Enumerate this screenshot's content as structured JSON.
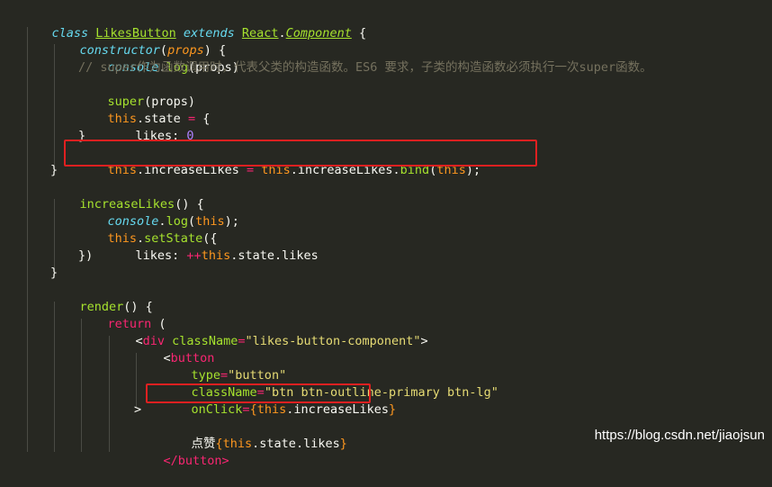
{
  "code": {
    "l1": {
      "kw_class": "class",
      "name": "LikesButton",
      "kw_extends": "extends",
      "base_obj": "React",
      "dot": ".",
      "base_cls": "Component",
      "brace": " {"
    },
    "l2": {
      "ctor": "constructor",
      "paren_open": "(",
      "param": "props",
      "rest": ") {"
    },
    "l3": {
      "obj": "console",
      "dot": ".",
      "fn": "log",
      "args": "(props)"
    },
    "l4": {
      "comment": "// super作为函数调用时，代表父类的构造函数。ES6 要求，子类的构造函数必须执行一次super函数。"
    },
    "l5": {
      "fn": "super",
      "args": "(props)"
    },
    "l6": {
      "this": "this",
      "prop": ".state ",
      "op": "=",
      "rest": " {"
    },
    "l7": {
      "key": "likes: ",
      "val": "0"
    },
    "l8": {
      "text": "}"
    },
    "l9": {
      "this1": "this",
      "prop1": ".increaseLikes ",
      "op": "=",
      "this2": "this",
      "prop2": ".increaseLikes.",
      "fn": "bind",
      "open": "(",
      "this3": "this",
      "close": ");"
    },
    "l10": {
      "text": "}"
    },
    "l11": {
      "fn": "increaseLikes",
      "rest": "() {"
    },
    "l12": {
      "obj": "console",
      "dot": ".",
      "fn": "log",
      "open": "(",
      "this": "this",
      "close": ");"
    },
    "l13": {
      "this": "this",
      "dot": ".",
      "fn": "setState",
      "rest": "({"
    },
    "l14": {
      "key": "likes: ",
      "op": "++",
      "this": "this",
      "rest": ".state.likes"
    },
    "l15": {
      "text": "})"
    },
    "l16": {
      "text": "}"
    },
    "l17": {
      "fn": "render",
      "rest": "() {"
    },
    "l18": {
      "kw": "return",
      "rest": " ("
    },
    "l19": {
      "lt": "<",
      "tag": "div",
      "attr": " className",
      "eq": "=",
      "str": "\"likes-button-component\"",
      "gt": ">"
    },
    "l20": {
      "lt": "<",
      "tag": "button"
    },
    "l21": {
      "attr": "type",
      "eq": "=",
      "str": "\"button\""
    },
    "l22": {
      "attr": "className",
      "eq": "=",
      "str": "\"btn btn-outline-primary btn-lg\""
    },
    "l23": {
      "attr": "onClick",
      "eq": "=",
      "open": "{",
      "this": "this",
      "rest": ".increaseLikes",
      "close": "}"
    },
    "l24": {
      "text": ">"
    },
    "l25": {
      "text": "点赞",
      "open": "{",
      "this": "this",
      "rest": ".state.likes",
      "close": "}"
    },
    "l26": {
      "text": "</button>"
    }
  },
  "watermark": "https://blog.csdn.net/jiaojsun"
}
